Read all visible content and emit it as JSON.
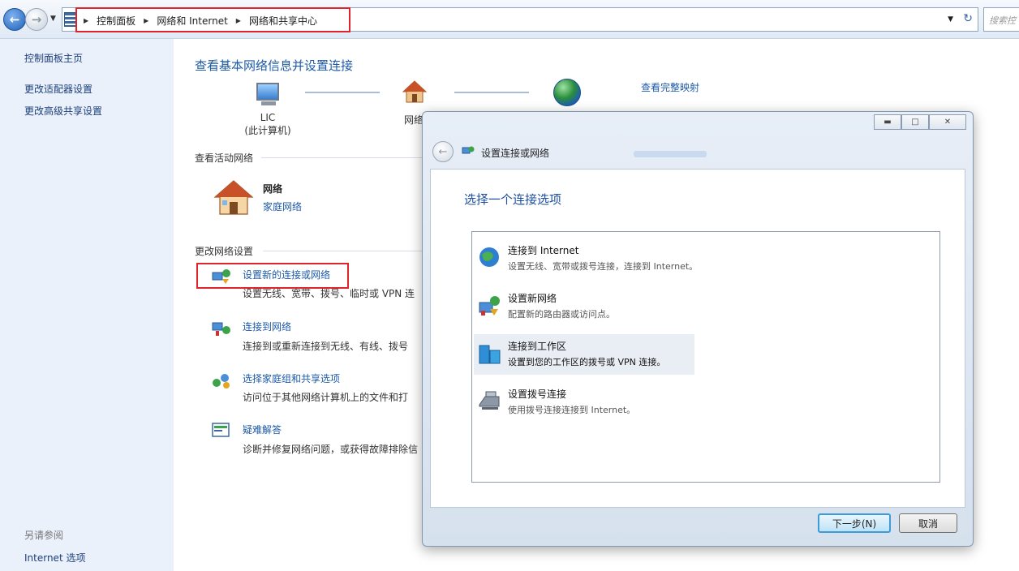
{
  "address_bar": {
    "breadcrumbs": [
      "控制面板",
      "网络和 Internet",
      "网络和共享中心"
    ],
    "search_placeholder": "搜索控"
  },
  "left_pane": {
    "links": [
      "控制面板主页",
      "更改适配器设置",
      "更改高级共享设置"
    ],
    "see_also_label": "另请参阅",
    "see_also_links": [
      "Internet 选项"
    ]
  },
  "main": {
    "title": "查看基本网络信息并设置连接",
    "computer_name": "LIC",
    "computer_sub": "(此计算机)",
    "network_node_label": "网络",
    "view_full_map": "查看完整映射",
    "active_networks_header": "查看活动网络",
    "network_name": "网络",
    "network_type": "家庭网络",
    "change_settings_header": "更改网络设置",
    "tasks": [
      {
        "link": "设置新的连接或网络",
        "desc": "设置无线、宽带、拨号、临时或 VPN 连"
      },
      {
        "link": "连接到网络",
        "desc": "连接到或重新连接到无线、有线、拨号"
      },
      {
        "link": "选择家庭组和共享选项",
        "desc": "访问位于其他网络计算机上的文件和打"
      },
      {
        "link": "疑难解答",
        "desc": "诊断并修复网络问题，或获得故障排除信"
      }
    ]
  },
  "dialog": {
    "title": "设置连接或网络",
    "heading": "选择一个连接选项",
    "options": [
      {
        "title": "连接到 Internet",
        "desc": "设置无线、宽带或拨号连接，连接到 Internet。"
      },
      {
        "title": "设置新网络",
        "desc": "配置新的路由器或访问点。"
      },
      {
        "title": "连接到工作区",
        "desc": "设置到您的工作区的拨号或 VPN 连接。"
      },
      {
        "title": "设置拨号连接",
        "desc": "使用拨号连接连接到 Internet。"
      }
    ],
    "selected_index": 2,
    "next_button": "下一步(N)",
    "cancel_button": "取消"
  },
  "colors": {
    "link_blue": "#1d5aa8",
    "highlight_red": "#e0242c",
    "left_pane_bg": "#eaf1fb"
  }
}
